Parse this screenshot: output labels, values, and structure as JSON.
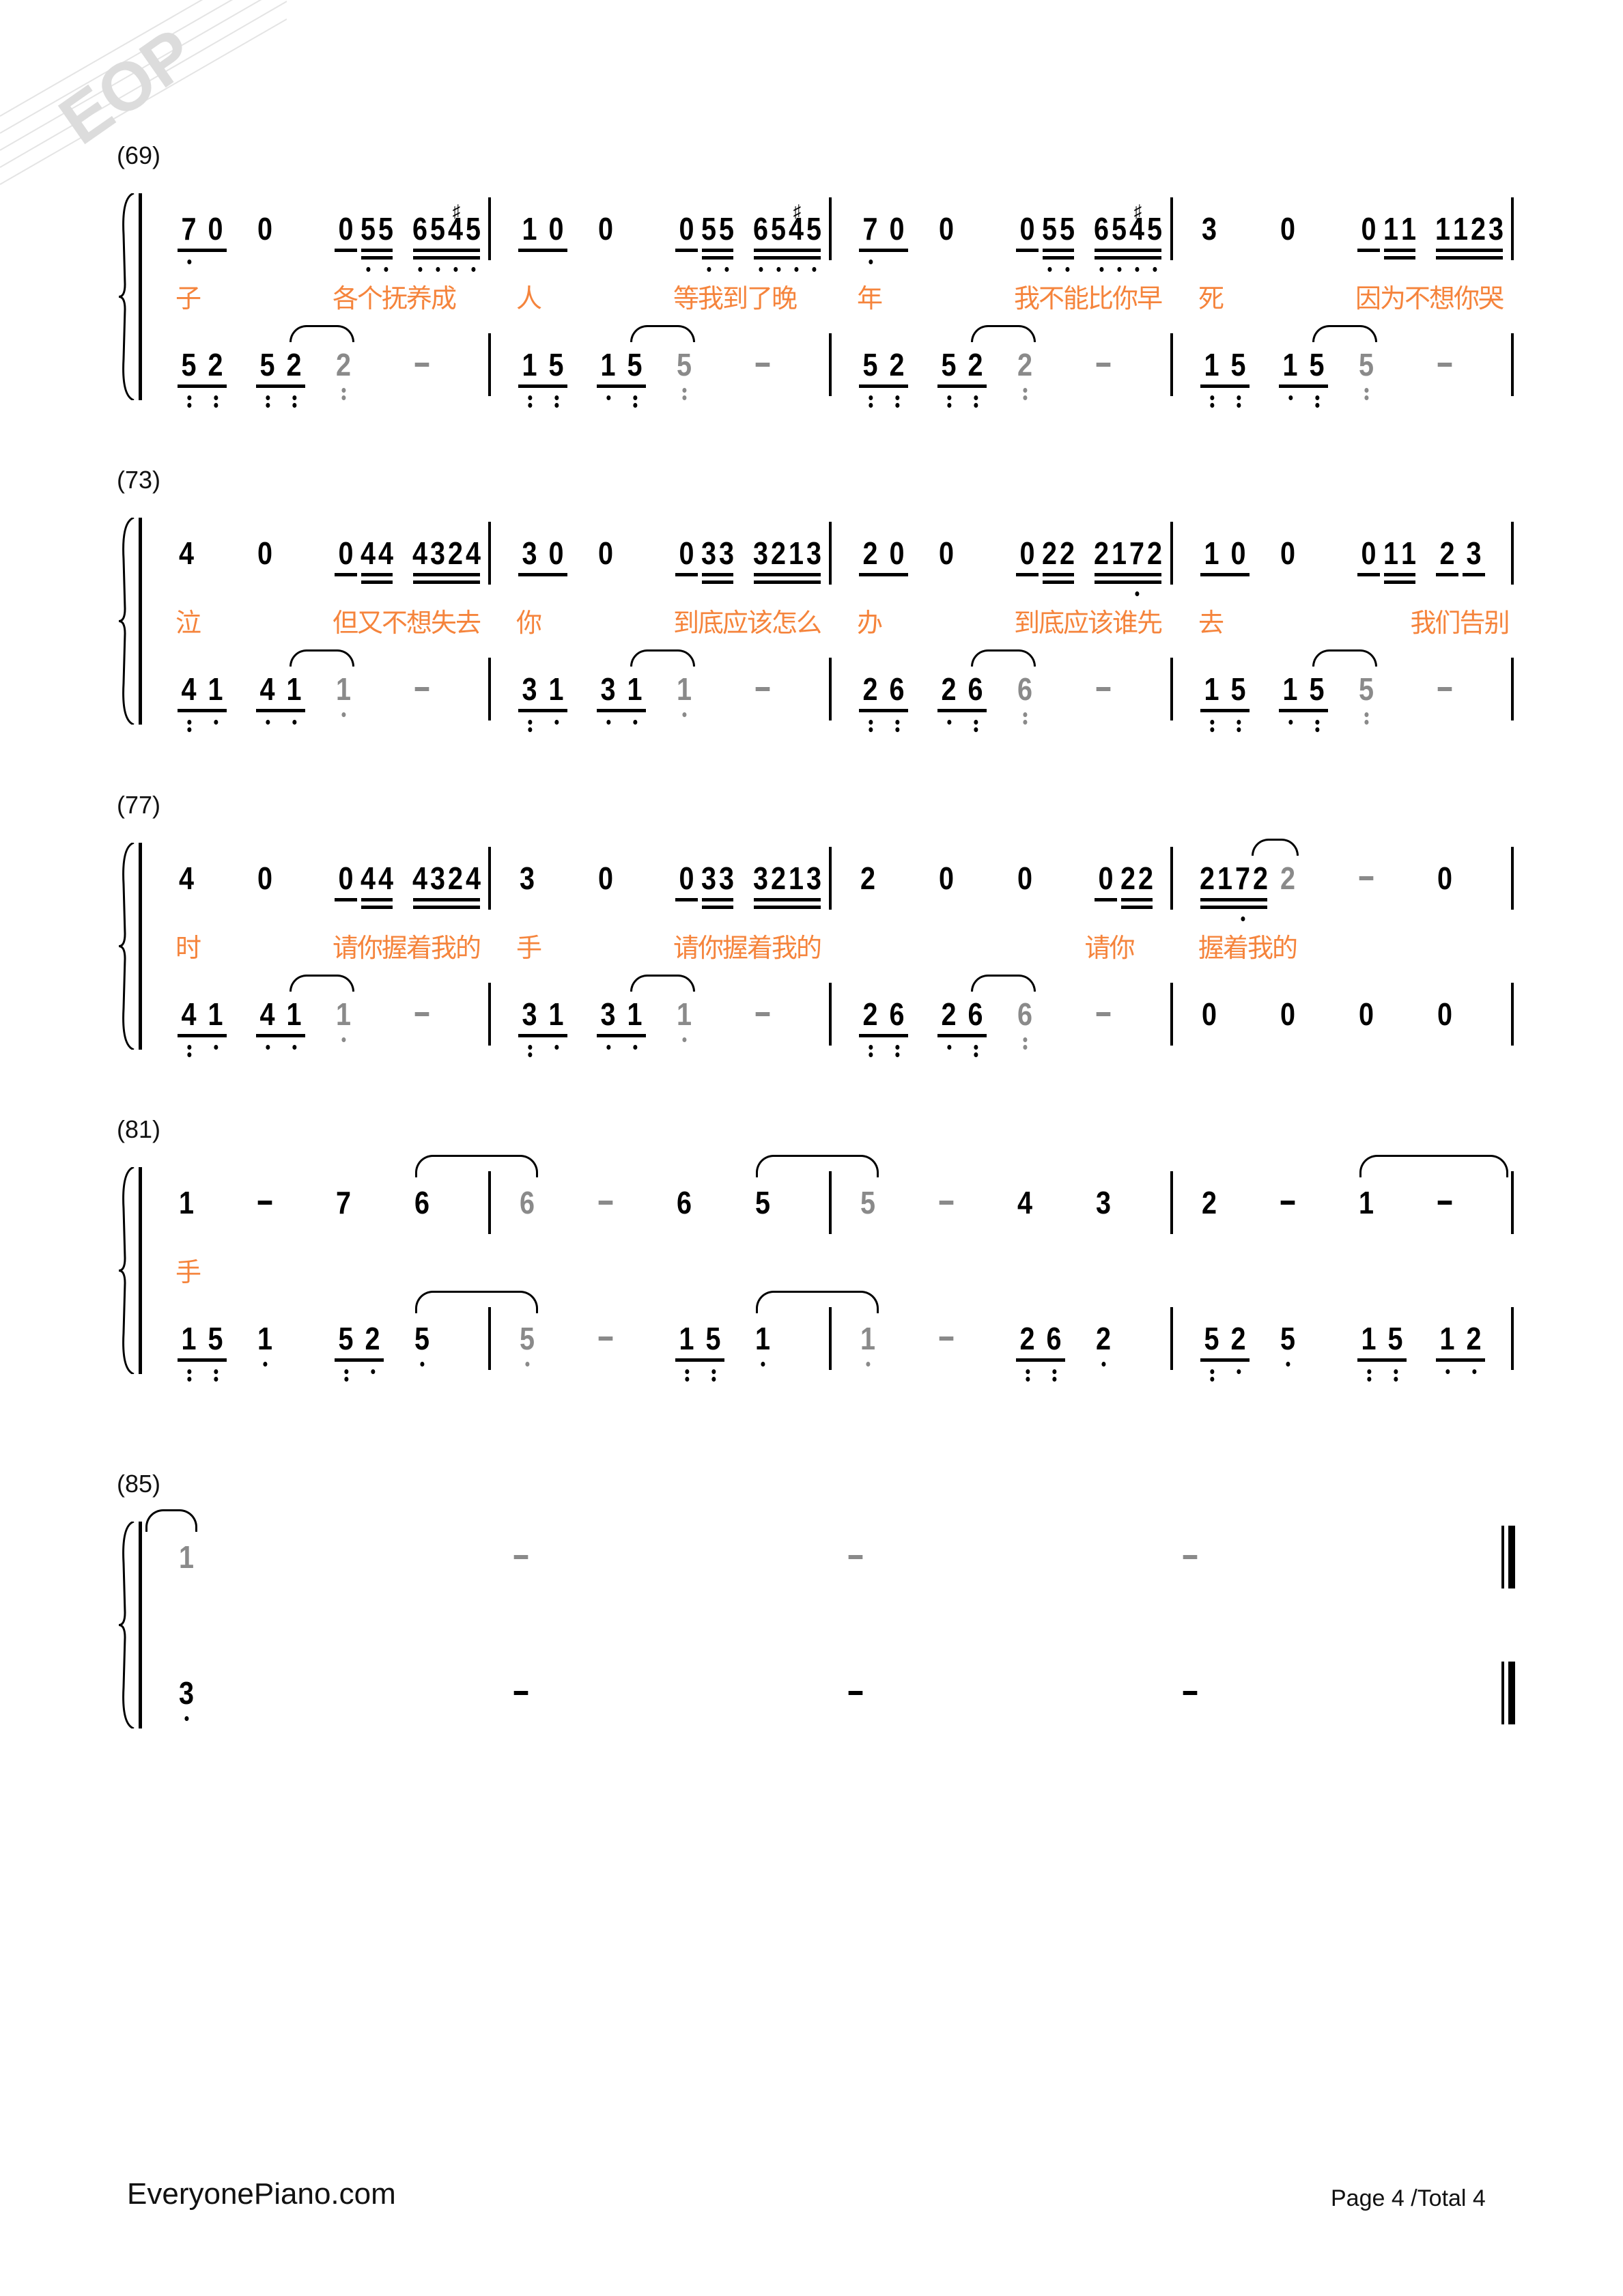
{
  "watermark": "EOP",
  "colors": {
    "lyric": "#f5843c",
    "tied_note": "#8a8a8a",
    "note": "#000000"
  },
  "footer": {
    "site": "EveryonePiano.com",
    "page": "Page 4 /Total 4"
  },
  "systems": [
    {
      "number": "(69)",
      "measures": [
        {
          "treble": [
            "70/1/10",
            "0",
            "0/1 55/2/11",
            "65#45/2/1111"
          ],
          "treble_ties": [],
          "lyrics": [
            [
              0,
              "子"
            ],
            [
              2,
              "各个抚养成"
            ]
          ],
          "bass": [
            "52/1/22",
            "52/1/22",
            "2/0/2/g",
            "-/0//g"
          ],
          "bass_ties": [
            [
              1,
              2
            ]
          ]
        },
        {
          "treble": [
            "10/1",
            "0",
            "0/1 55/2/11",
            "65#45/2/1111"
          ],
          "treble_ties": [],
          "lyrics": [
            [
              0,
              "人"
            ],
            [
              2,
              "等我到了晚"
            ]
          ],
          "bass": [
            "15/1/22",
            "15/1/12",
            "5/0/2/g",
            "-/0//g"
          ],
          "bass_ties": [
            [
              1,
              2
            ]
          ]
        },
        {
          "treble": [
            "70/1/10",
            "0",
            "0/1 55/2/11",
            "65#45/2/1111"
          ],
          "treble_ties": [],
          "lyrics": [
            [
              0,
              "年"
            ],
            [
              2,
              "我不能比你早"
            ]
          ],
          "bass": [
            "52/1/22",
            "52/1/22",
            "2/0/2/g",
            "-/0//g"
          ],
          "bass_ties": [
            [
              1,
              2
            ]
          ]
        },
        {
          "treble": [
            "3",
            "0",
            "0/1 11/2",
            "1123/2"
          ],
          "treble_ties": [],
          "lyrics": [
            [
              0,
              "死"
            ],
            [
              2,
              "因为不想你哭"
            ]
          ],
          "bass": [
            "15/1/22",
            "15/1/12",
            "5/0/2/g",
            "-/0//g"
          ],
          "bass_ties": [
            [
              1,
              2
            ]
          ]
        }
      ]
    },
    {
      "number": "(73)",
      "measures": [
        {
          "treble": [
            "4",
            "0",
            "0/1 44/2",
            "4324/2"
          ],
          "treble_ties": [],
          "lyrics": [
            [
              0,
              "泣"
            ],
            [
              2,
              "但又不想失去"
            ]
          ],
          "bass": [
            "41/1/21",
            "41/1/11",
            "1/0/1/g",
            "-/0//g"
          ],
          "bass_ties": [
            [
              1,
              2
            ]
          ]
        },
        {
          "treble": [
            "30/1",
            "0",
            "0/1 33/2",
            "3213/2"
          ],
          "treble_ties": [],
          "lyrics": [
            [
              0,
              "你"
            ],
            [
              2,
              "到底应该怎么"
            ]
          ],
          "bass": [
            "31/1/21",
            "31/1/11",
            "1/0/1/g",
            "-/0//g"
          ],
          "bass_ties": [
            [
              1,
              2
            ]
          ]
        },
        {
          "treble": [
            "20/1",
            "0",
            "0/1 22/2",
            "2172/2/0010"
          ],
          "treble_ties": [],
          "lyrics": [
            [
              0,
              "办"
            ],
            [
              2,
              "到底应该谁先"
            ]
          ],
          "bass": [
            "26/1/22",
            "26/1/12",
            "6/0/2/g",
            "-/0//g"
          ],
          "bass_ties": [
            [
              1,
              2
            ]
          ]
        },
        {
          "treble": [
            "10/1",
            "0",
            "0/1 11/2",
            "2/1 3/1"
          ],
          "treble_ties": [],
          "lyrics": [
            [
              0,
              "去"
            ],
            [
              2.7,
              "我们告别"
            ]
          ],
          "bass": [
            "15/1/22",
            "15/1/12",
            "5/0/2/g",
            "-/0//g"
          ],
          "bass_ties": [
            [
              1,
              2
            ]
          ]
        }
      ]
    },
    {
      "number": "(77)",
      "measures": [
        {
          "treble": [
            "4",
            "0",
            "0/1 44/2",
            "4324/2"
          ],
          "treble_ties": [],
          "lyrics": [
            [
              0,
              "时"
            ],
            [
              2,
              "请你握着我的"
            ]
          ],
          "bass": [
            "41/1/21",
            "41/1/11",
            "1/0/1/g",
            "-/0//g"
          ],
          "bass_ties": [
            [
              1,
              2
            ]
          ]
        },
        {
          "treble": [
            "3",
            "0",
            "0/1 33/2",
            "3213/2"
          ],
          "treble_ties": [],
          "lyrics": [
            [
              0,
              "手"
            ],
            [
              2,
              "请你握着我的"
            ]
          ],
          "bass": [
            "31/1/21",
            "31/1/11",
            "1/0/1/g",
            "-/0//g"
          ],
          "bass_ties": [
            [
              1,
              2
            ]
          ]
        },
        {
          "treble": [
            "2",
            "0",
            "0",
            "0/1 22/2"
          ],
          "treble_ties": [],
          "lyrics": [
            [
              2.9,
              "请你"
            ]
          ],
          "bass": [
            "26/1/22",
            "26/1/12",
            "6/0/2/g",
            "-/0//g"
          ],
          "bass_ties": [
            [
              1,
              2
            ]
          ]
        },
        {
          "treble": [
            "2172/2/0010",
            "2/0//g",
            "-/0//g",
            "0"
          ],
          "treble_ties": [
            [
              0,
              1
            ]
          ],
          "lyrics": [
            [
              0,
              "握着我的"
            ]
          ],
          "bass": [
            "0",
            "0",
            "0",
            "0"
          ],
          "bass_ties": []
        }
      ]
    },
    {
      "number": "(81)",
      "measures": [
        {
          "treble": [
            "1",
            "-",
            "7",
            "6"
          ],
          "treble_ties": [
            [
              3,
              4
            ]
          ],
          "lyrics": [
            [
              0,
              "手"
            ]
          ],
          "bass": [
            "15/1/22",
            "1/0/1",
            "52/1/21",
            "5/0/1"
          ],
          "bass_ties": [
            [
              3,
              4
            ]
          ]
        },
        {
          "treble": [
            "6/0//g",
            "-/0//g",
            "6",
            "5"
          ],
          "treble_ties": [
            [
              3,
              4
            ]
          ],
          "lyrics": [],
          "bass": [
            "5/0/1/g",
            "-/0//g",
            "15/1/22",
            "1/0/1"
          ],
          "bass_ties": [
            [
              3,
              4
            ]
          ]
        },
        {
          "treble": [
            "5/0//g",
            "-/0//g",
            "4",
            "3"
          ],
          "treble_ties": [],
          "lyrics": [],
          "bass": [
            "1/0/1/g",
            "-/0//g",
            "26/1/22",
            "2/0/1"
          ],
          "bass_ties": []
        },
        {
          "treble": [
            "2",
            "-",
            "1",
            "-"
          ],
          "treble_ties": [
            [
              2,
              4
            ]
          ],
          "lyrics": [],
          "bass": [
            "52/1/21",
            "5/0/1",
            "15/1/22",
            "12/1/11"
          ],
          "bass_ties": []
        }
      ]
    },
    {
      "number": "(85)",
      "final": true,
      "measures": [
        {
          "treble": [
            "1/0//g",
            "-/0//g",
            "-/0//g",
            "-/0//g"
          ],
          "treble_ties": [
            [
              -1,
              0
            ]
          ],
          "lyrics": [],
          "bass": [
            "3/0/1",
            "-",
            "-",
            "-"
          ],
          "bass_ties": []
        }
      ]
    }
  ]
}
